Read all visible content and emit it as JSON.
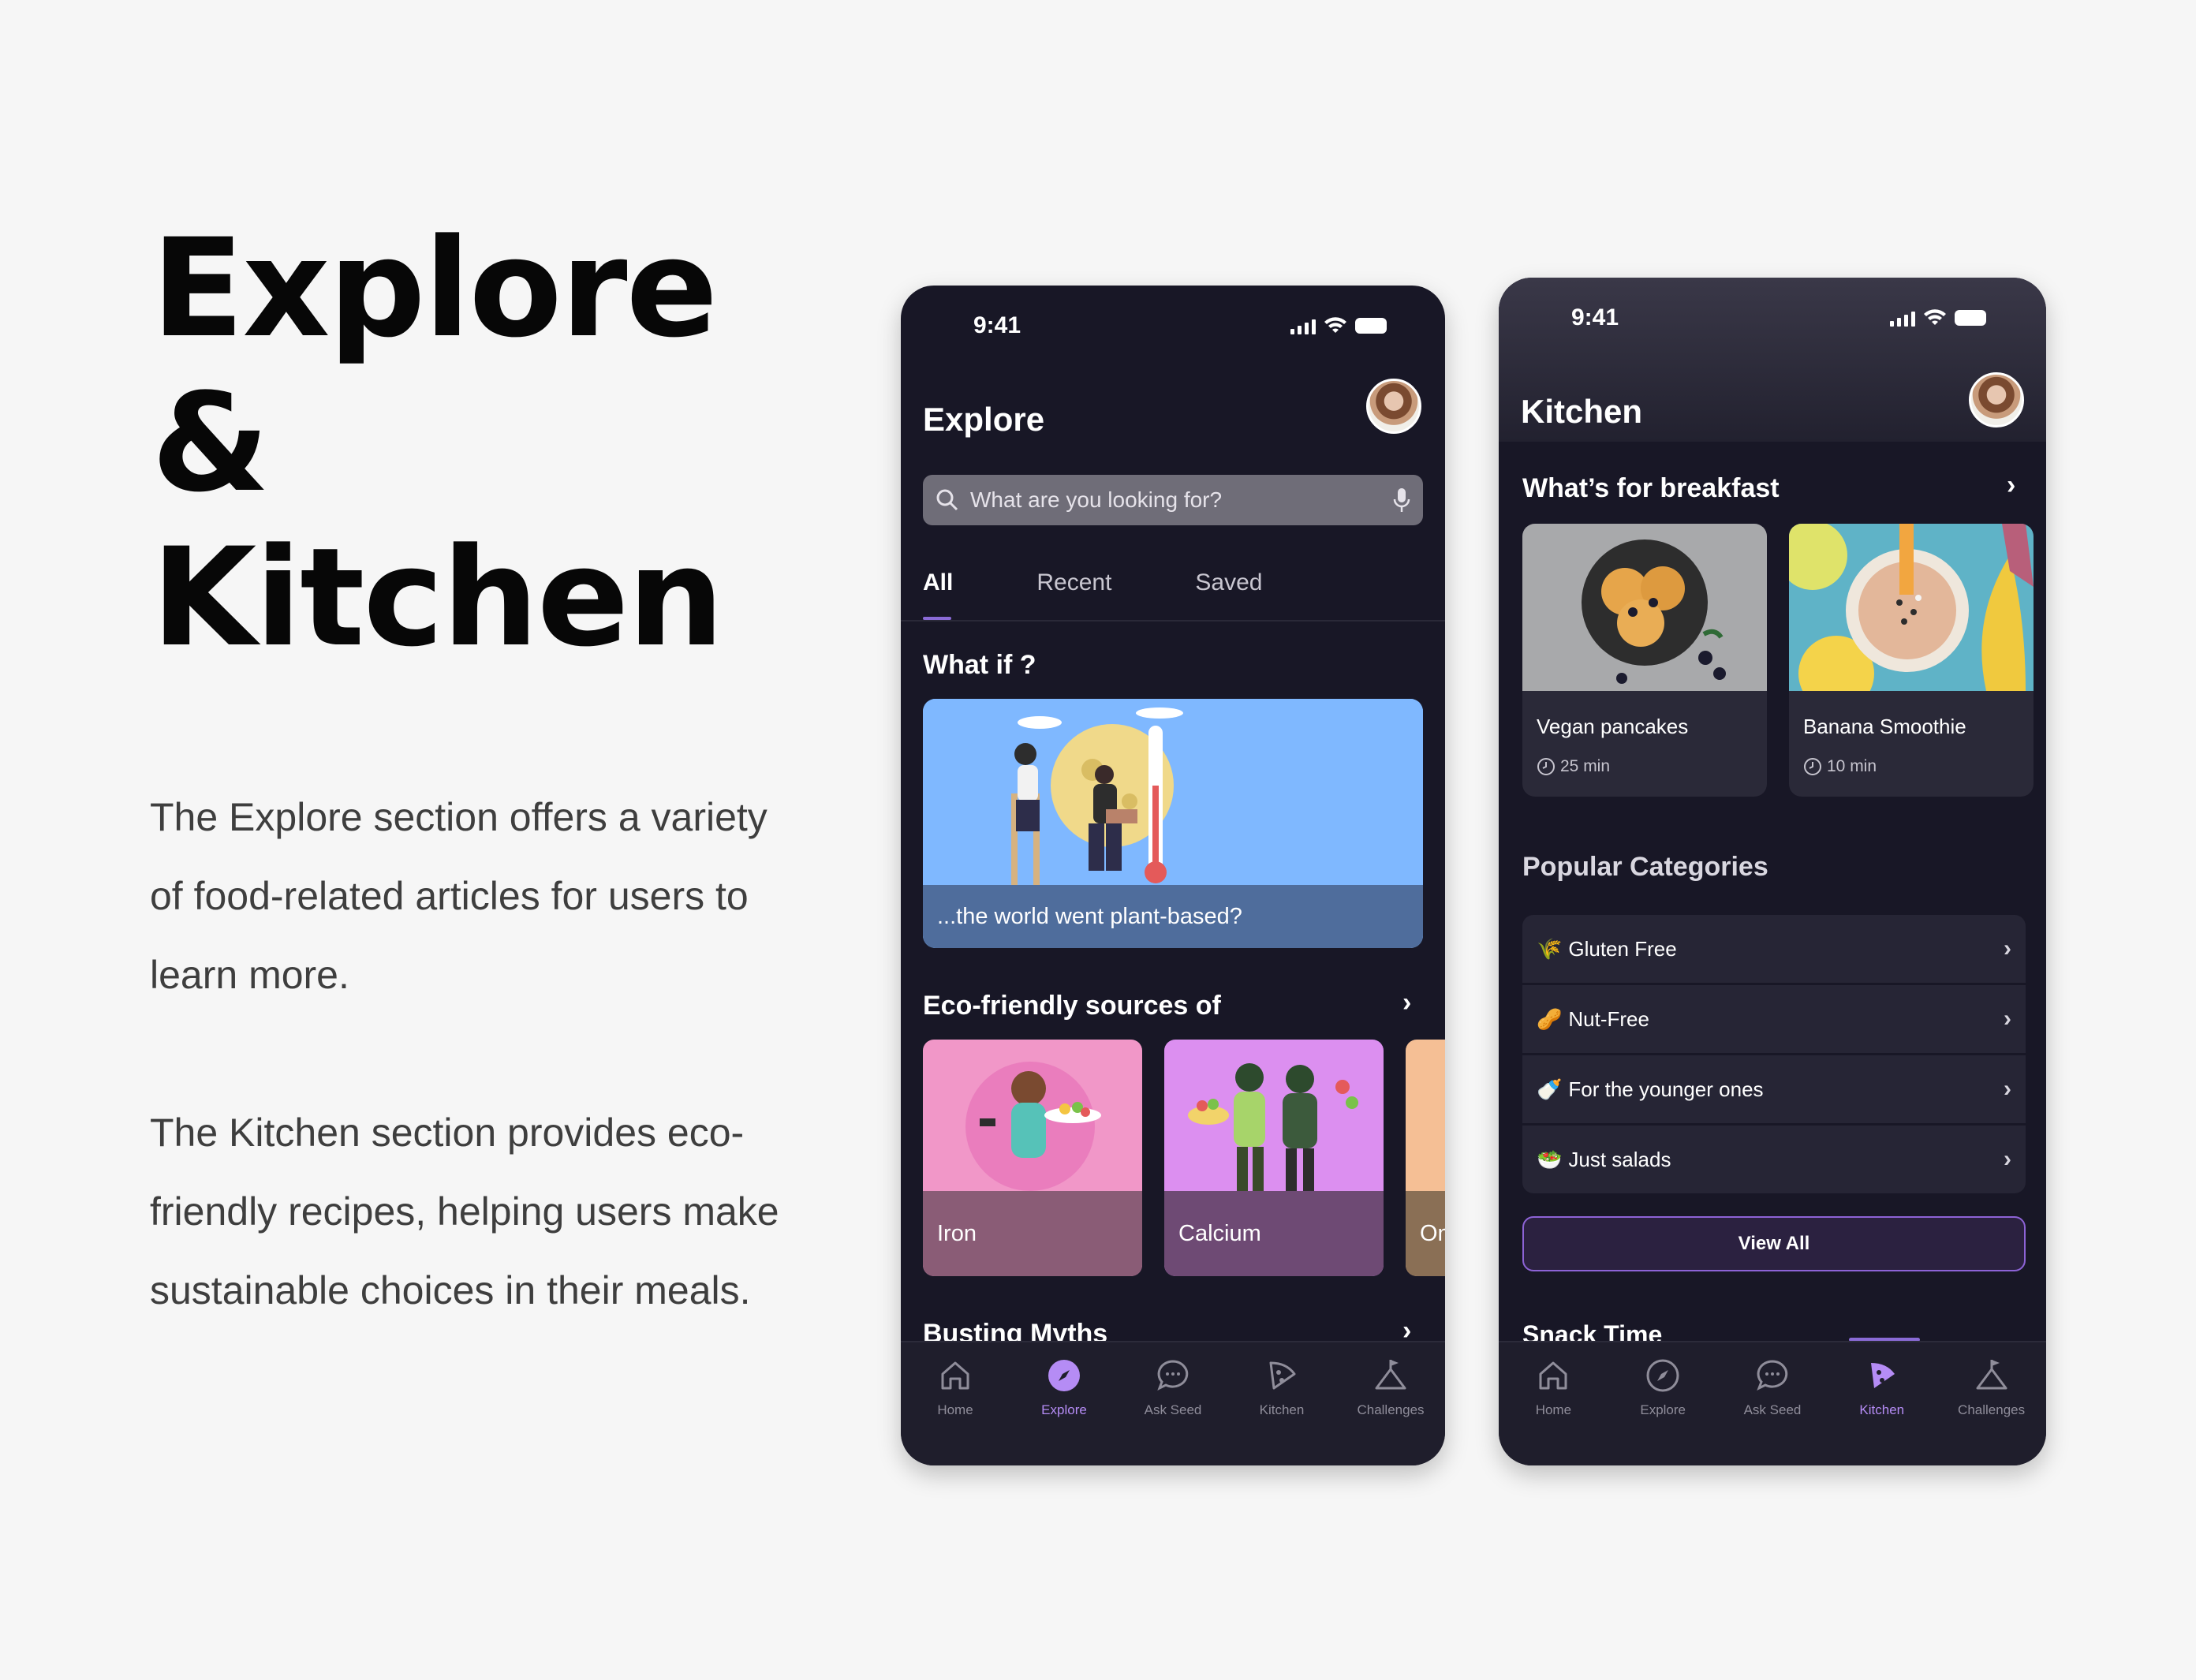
{
  "left": {
    "headline": [
      "Explore",
      "&",
      "Kitchen"
    ],
    "paragraph1": "The Explore section offers a variety of food-related articles for users to learn more.",
    "paragraph2": "The Kitchen section provides eco-friendly recipes, helping users make sustainable choices in their meals."
  },
  "explore_screen": {
    "status_time": "9:41",
    "title": "Explore",
    "search_placeholder": "What are you looking for?",
    "tabs": [
      {
        "label": "All",
        "active": true
      },
      {
        "label": "Recent",
        "active": false
      },
      {
        "label": "Saved",
        "active": false
      }
    ],
    "what_if_title": "What if ?",
    "hero_caption": "...the world went plant-based?",
    "eco_title": "Eco-friendly sources of",
    "eco_cards": [
      {
        "label": "Iron",
        "color": "#f197c8",
        "label_bg": "#8a5c76"
      },
      {
        "label": "Calcium",
        "color": "#dc8ff0",
        "label_bg": "#6e4a74"
      },
      {
        "label": "Om",
        "color": "#f5bf95",
        "label_bg": "#8a6f55"
      }
    ],
    "busting_title": "Busting Myths"
  },
  "kitchen_screen": {
    "status_time": "9:41",
    "title": "Kitchen",
    "breakfast_title": "What’s for breakfast",
    "recipes": [
      {
        "name": "Vegan pancakes",
        "time": "25 min"
      },
      {
        "name": "Banana Smoothie",
        "time": "10 min"
      }
    ],
    "popular_title": "Popular Categories",
    "categories": [
      {
        "emoji": "🌾",
        "label": "Gluten Free"
      },
      {
        "emoji": "🥜",
        "label": "Nut-Free"
      },
      {
        "emoji": "🍼",
        "label": "For the younger ones"
      },
      {
        "emoji": "🥗",
        "label": "Just salads"
      }
    ],
    "view_all": "View All",
    "snack_title": "Snack Time"
  },
  "nav": {
    "items": [
      "Home",
      "Explore",
      "Ask Seed",
      "Kitchen",
      "Challenges"
    ]
  },
  "colors": {
    "phone_bg": "#181726",
    "accent": "#b58cf5"
  }
}
